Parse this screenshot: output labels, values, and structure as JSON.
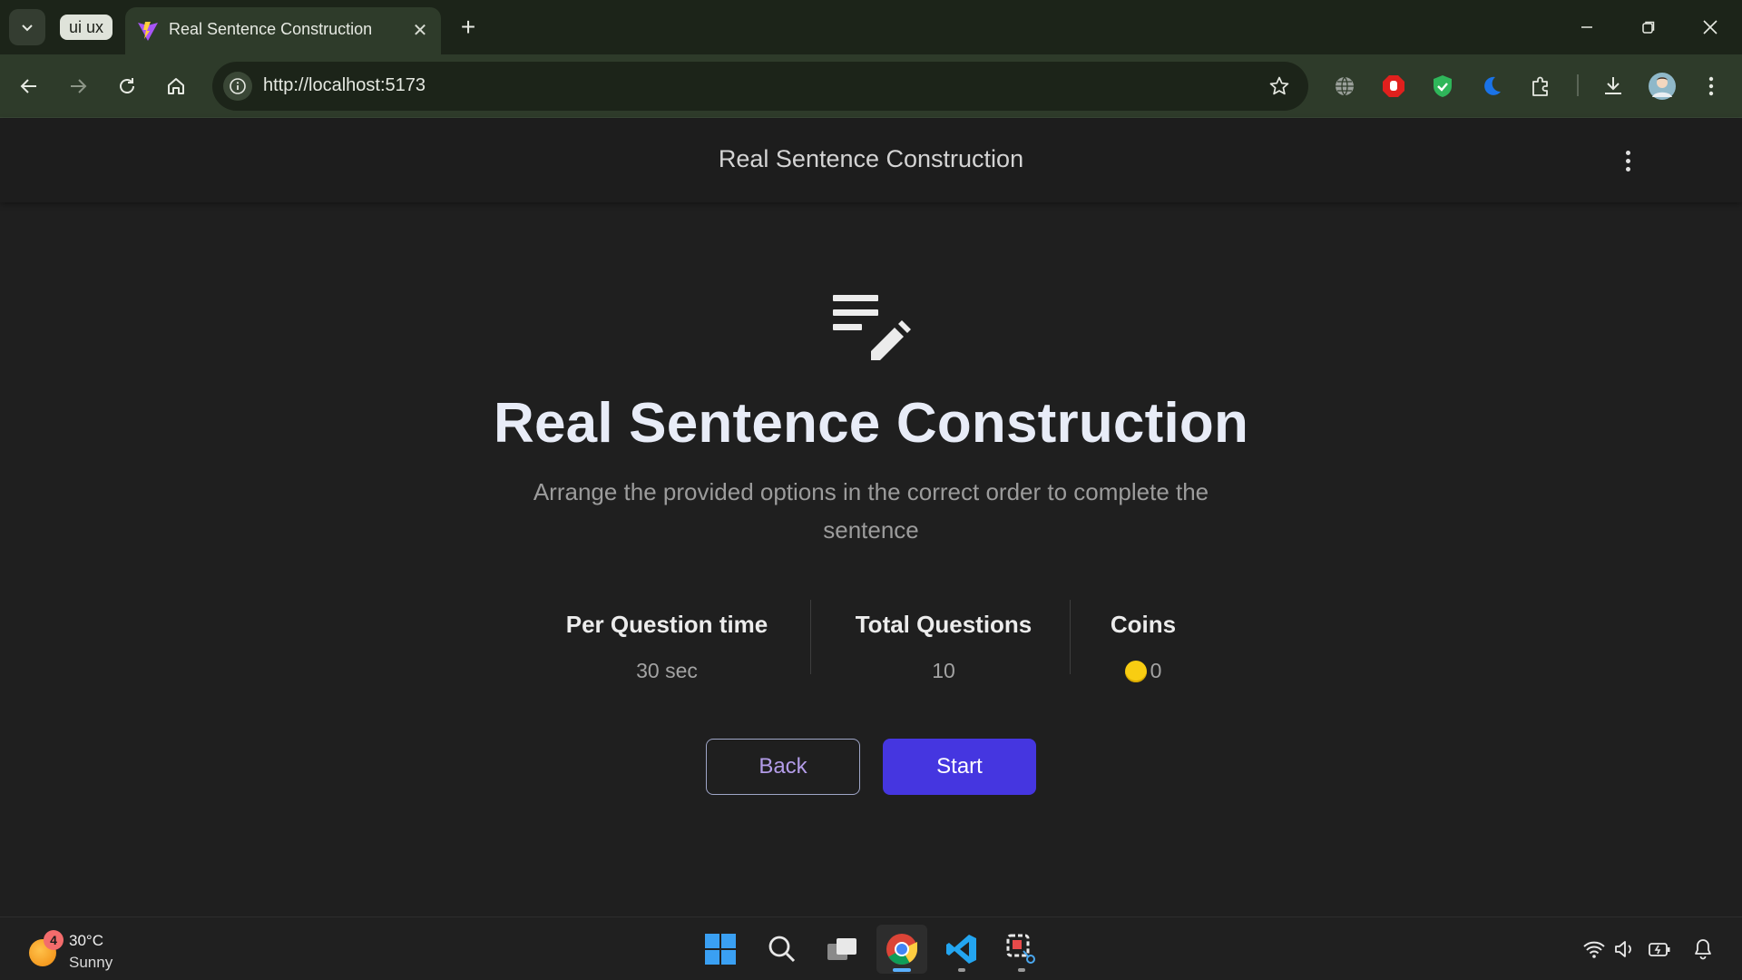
{
  "browser": {
    "tab_group_label": "ui ux",
    "active_tab_title": "Real Sentence Construction",
    "url": "http://localhost:5173"
  },
  "page": {
    "header_title": "Real Sentence Construction",
    "title": "Real Sentence Construction",
    "subtitle": "Arrange the provided options in the correct order to complete the sentence",
    "stats": [
      {
        "label": "Per Question time",
        "value": "30 sec"
      },
      {
        "label": "Total Questions",
        "value": "10"
      },
      {
        "label": "Coins",
        "value": "0"
      }
    ],
    "back_label": "Back",
    "start_label": "Start"
  },
  "taskbar": {
    "weather_badge": "4",
    "weather_temp": "30°C",
    "weather_condition": "Sunny",
    "apps": [
      "start-menu",
      "search",
      "task-view",
      "chrome",
      "vscode",
      "snipping-tool"
    ]
  },
  "colors": {
    "accent": "#4536e0",
    "back_text": "#b39ce8",
    "coin": "#f8cd12",
    "page_bg": "#1f1f1f",
    "chrome_bg": "#2e3b2a"
  }
}
